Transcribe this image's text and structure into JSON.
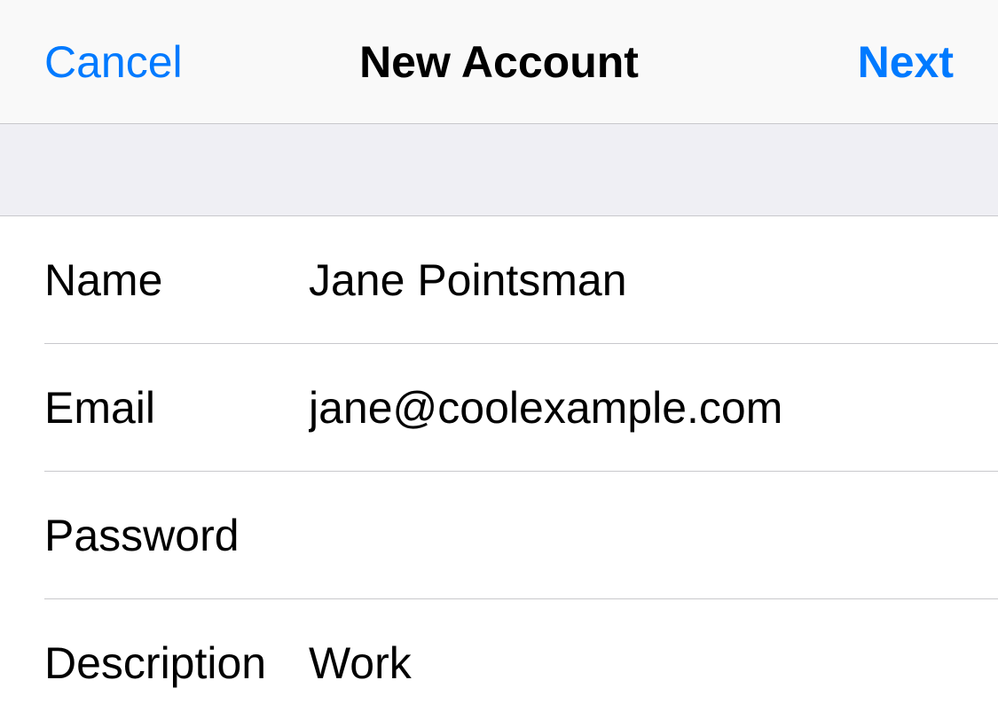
{
  "nav": {
    "cancel": "Cancel",
    "title": "New Account",
    "next": "Next"
  },
  "form": {
    "name": {
      "label": "Name",
      "value": "Jane Pointsman"
    },
    "email": {
      "label": "Email",
      "value": "jane@coolexample.com"
    },
    "password": {
      "label": "Password",
      "value": ""
    },
    "description": {
      "label": "Description",
      "value": "Work"
    }
  }
}
